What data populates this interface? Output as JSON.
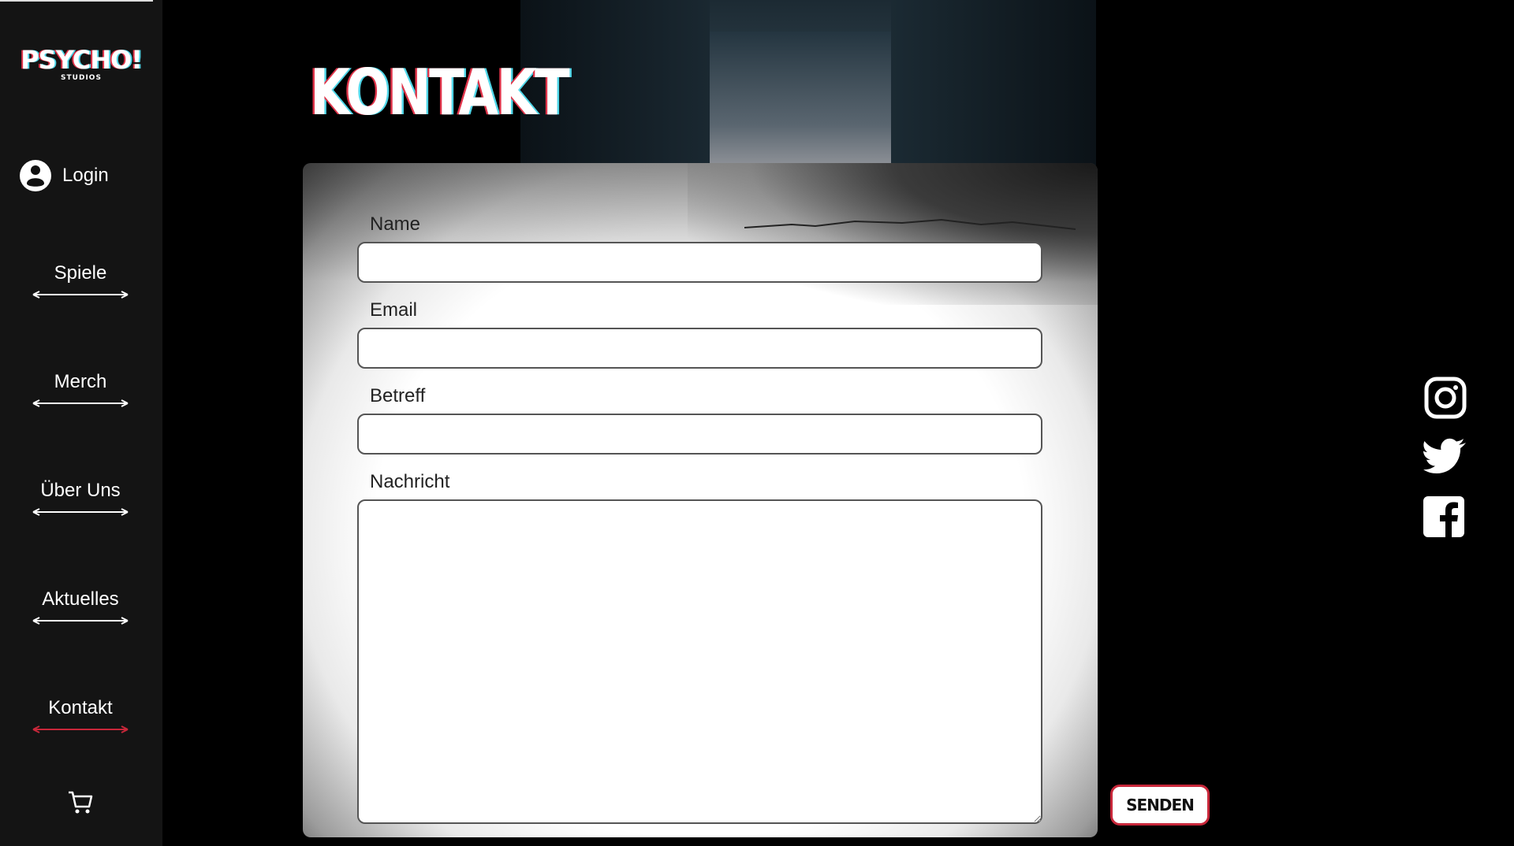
{
  "sidebar": {
    "logo": {
      "brand": "PSYCHO!",
      "sub": "STUDIOS"
    },
    "login_label": "Login",
    "items": [
      {
        "label": "Spiele",
        "active": false
      },
      {
        "label": "Merch",
        "active": false
      },
      {
        "label": "Über Uns",
        "active": false
      },
      {
        "label": "Aktuelles",
        "active": false
      },
      {
        "label": "Kontakt",
        "active": true
      }
    ],
    "cart_icon": "cart-icon"
  },
  "main": {
    "title": "KONTAKT",
    "form": {
      "name_label": "Name",
      "name_value": "",
      "email_label": "Email",
      "email_value": "",
      "subject_label": "Betreff",
      "subject_value": "",
      "message_label": "Nachricht",
      "message_value": ""
    },
    "send_label": "SENDEN"
  },
  "social": [
    "instagram-icon",
    "twitter-icon",
    "facebook-icon"
  ],
  "colors": {
    "accent": "#c8273a",
    "glitch_red": "#e0344a",
    "glitch_cyan": "#4fd6e8",
    "sidebar_bg": "#141414"
  }
}
